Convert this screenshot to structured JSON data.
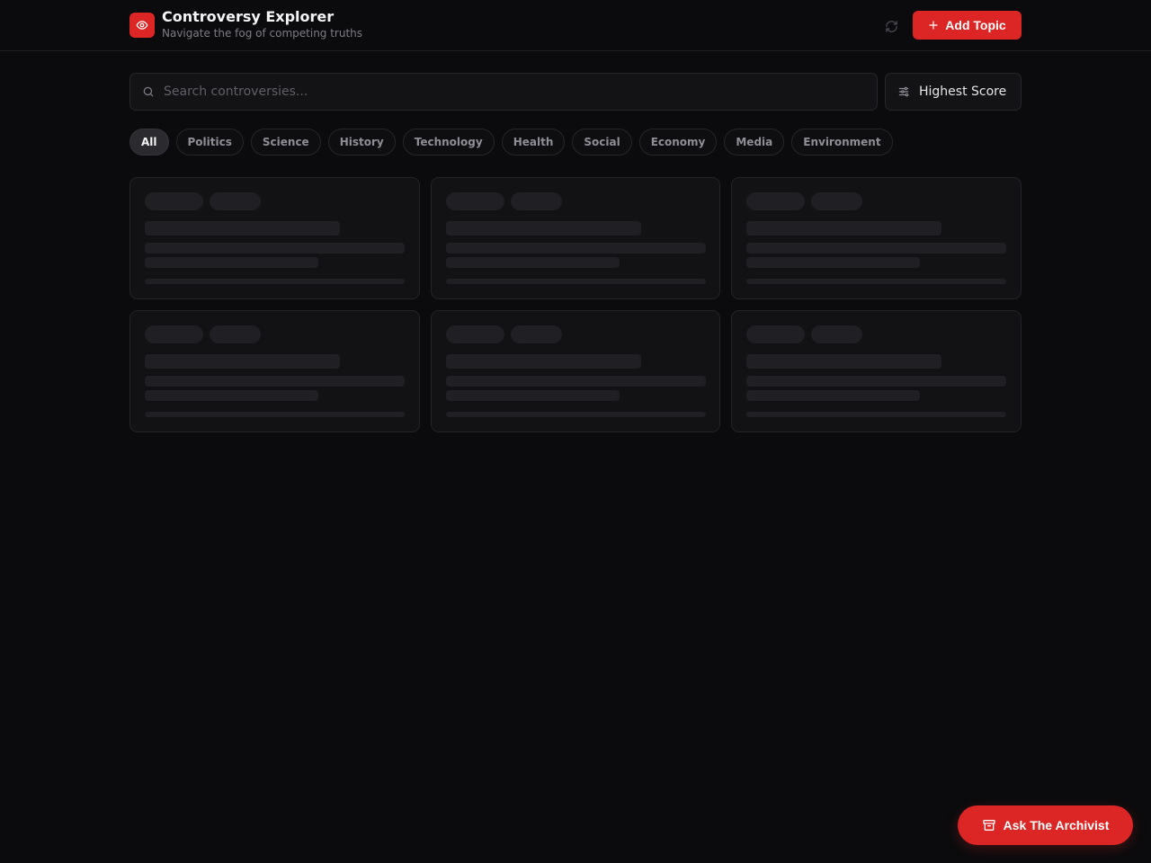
{
  "header": {
    "title": "Controversy Explorer",
    "subtitle": "Navigate the fog of competing truths",
    "logo_icon": "eye-icon",
    "refresh_icon": "refresh-icon",
    "add_button_label": "Add Topic"
  },
  "search": {
    "placeholder": "Search controversies...",
    "value": ""
  },
  "sort": {
    "selected": "Highest Score",
    "icon": "sliders-icon"
  },
  "categories": {
    "items": [
      "All",
      "Politics",
      "Science",
      "History",
      "Technology",
      "Health",
      "Social",
      "Economy",
      "Media",
      "Environment"
    ],
    "active": "All"
  },
  "colors": {
    "accent": "#dc2626",
    "background": "#0b0b0d",
    "card": "#121215",
    "skeleton": "#1f1f24"
  },
  "fab": {
    "label": "Ask The Archivist",
    "icon": "archive-icon"
  }
}
